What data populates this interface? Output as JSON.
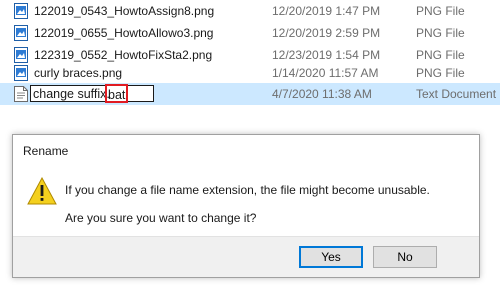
{
  "files": [
    {
      "name": "122019_0543_HowtoAssign8.png",
      "date": "12/20/2019 1:47 PM",
      "type": "PNG File",
      "icon": "png-file-icon"
    },
    {
      "name": "122019_0655_HowtoAllowo3.png",
      "date": "12/20/2019 2:59 PM",
      "type": "PNG File",
      "icon": "png-file-icon"
    },
    {
      "name": "122319_0552_HowtoFixSta2.png",
      "date": "12/23/2019 1:54 PM",
      "type": "PNG File",
      "icon": "png-file-icon"
    },
    {
      "name": "curly braces.png",
      "date": "1/14/2020 11:57 AM",
      "type": "PNG File",
      "icon": "png-file-icon"
    }
  ],
  "renaming": {
    "base": "change suffix.",
    "ext": "bat",
    "date": "4/7/2020 11:38 AM",
    "type": "Text Document",
    "icon": "text-document-icon"
  },
  "dialog": {
    "title": "Rename",
    "icon": "warning-icon",
    "message": "If you change a file name extension, the file might become unusable.",
    "question": "Are you sure you want to change it?",
    "yes_label": "Yes",
    "no_label": "No"
  },
  "colors": {
    "selection": "#cce8ff",
    "highlight_border": "#e11b22",
    "warning": "#f4d01e",
    "primary_button_border": "#0078d7"
  }
}
